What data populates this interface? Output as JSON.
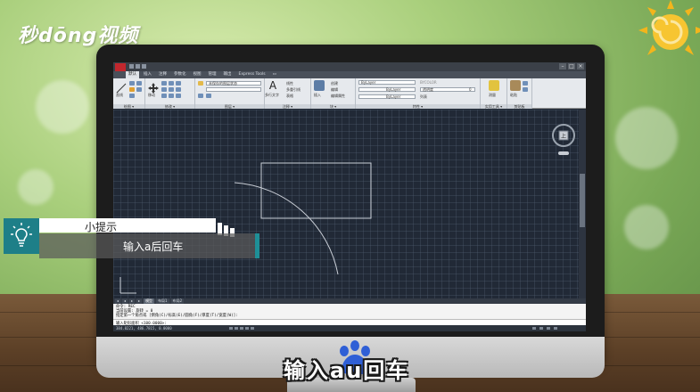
{
  "watermark": {
    "logo_text": "秒dōng视频"
  },
  "cad": {
    "title_bar": {
      "app_icon": "autocad-a-icon",
      "window_buttons": [
        "–",
        "□",
        "×"
      ]
    },
    "ribbon_tabs": [
      "默认",
      "插入",
      "注释",
      "参数化",
      "视图",
      "管理",
      "输出",
      "Express Tools",
      "▭"
    ],
    "active_tab_index": 0,
    "panels": {
      "draw": {
        "label": "绘图 ▾",
        "line": "直线",
        "polyline": "多段线",
        "circle": "圆",
        "arc": "圆弧"
      },
      "modify": {
        "label": "修改 ▾",
        "move": "移动"
      },
      "layers": {
        "label": "图层 ▾",
        "current_layer": "未保存的图层状态"
      },
      "annotation": {
        "label": "注释 ▾",
        "text": "多行文字",
        "dimension": "线性",
        "leader": "多重引线",
        "table": "表格"
      },
      "block": {
        "label": "块 ▾",
        "insert": "插入",
        "create": "创建",
        "edit": "编辑",
        "edit_attr": "编辑属性"
      },
      "properties": {
        "label": "特性 ▾",
        "color": "ByLayer",
        "linetype": "ByLayer",
        "lineweight": "ByLayer",
        "colorname": "BYCOLOR",
        "match": "特性匹配",
        "list": "列表",
        "transparency": "透明度",
        "transparency_value": "0"
      },
      "group": {
        "label": "实用工具 ▾",
        "measure": "测量"
      },
      "clipboard": {
        "label": "剪贴板",
        "paste": "粘贴"
      }
    },
    "model_tabs": [
      "◂",
      "◂",
      "▸",
      "▸",
      "模型",
      "布局1",
      "布局2"
    ],
    "active_model_tab_index": 4,
    "command_history": [
      "命令: REC",
      "当前设置: 旋转 = 0",
      "指定第一个角点或 [倒角(C)/标高(E)/圆角(F)/厚度(T)/宽度(W)]:",
      "指定另一个角点或 [面积(A)/尺寸(D)/旋转(R)]: a"
    ],
    "command_prompt": "输入矩形面积 <100.0000>:",
    "status_coords": "384.8221, 486.7815, 0.0000"
  },
  "tip": {
    "icon": "lightbulb-icon",
    "title": "小提示",
    "body": "输入a后回车"
  },
  "subtitle": {
    "text": "输入au回车",
    "paw_icon": "baidu-paw-icon"
  }
}
